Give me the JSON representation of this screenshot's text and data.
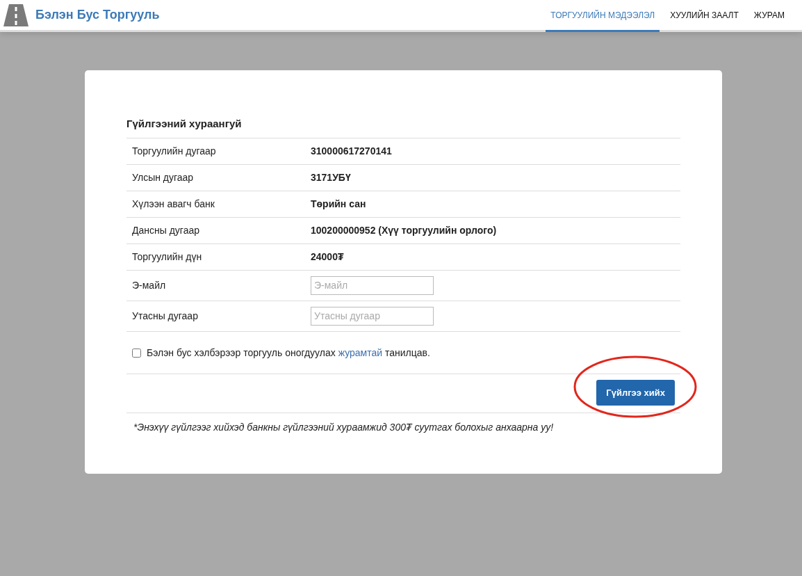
{
  "brand": {
    "title": "Бэлэн Бус Торгууль"
  },
  "nav": [
    {
      "label": "ТОРГУУЛИЙН МЭДЭЭЛЭЛ",
      "selected": true
    },
    {
      "label": "ХУУЛИЙН ЗААЛТ",
      "selected": false
    },
    {
      "label": "ЖУРАМ",
      "selected": false
    }
  ],
  "summary": {
    "title": "Гүйлгээний хураангуй",
    "rows": [
      {
        "kind": "text",
        "label": "Торгуулийн дугаар",
        "value": "310000617270141"
      },
      {
        "kind": "text",
        "label": "Улсын дугаар",
        "value": "3171УБҮ"
      },
      {
        "kind": "text",
        "label": "Хүлээн авагч банк",
        "value": "Төрийн сан"
      },
      {
        "kind": "text",
        "label": "Дансны дугаар",
        "value": "100200000952 (Хүү торгуулийн орлого)"
      },
      {
        "kind": "text",
        "label": "Торгуулийн дүн",
        "value": "24000₮"
      },
      {
        "kind": "input",
        "label": "Э-майл",
        "placeholder": "Э-майл"
      },
      {
        "kind": "input",
        "label": "Утасны дугаар",
        "placeholder": "Утасны дугаар"
      }
    ]
  },
  "agreement": {
    "checked": false,
    "text_before": "Бэлэн бус хэлбэрээр торгууль оногдуулах",
    "link": "журамтай",
    "text_after": "танилцав."
  },
  "submit_button": "Гүйлгээ хийх",
  "note": "*Энэхүү гүйлгээг хийхэд банкны гүйлгээний хураамжид 300₮ суутгах болохыг анхаарна уу!"
}
